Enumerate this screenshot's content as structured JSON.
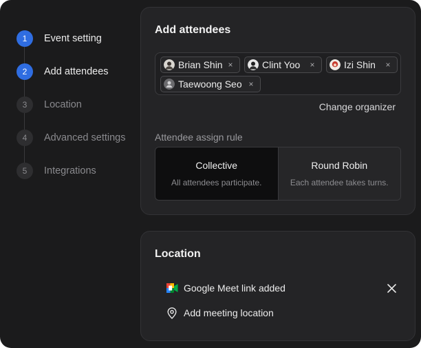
{
  "steps": [
    {
      "number": "1",
      "label": "Event setting",
      "active": true
    },
    {
      "number": "2",
      "label": "Add attendees",
      "active": true
    },
    {
      "number": "3",
      "label": "Location",
      "active": false
    },
    {
      "number": "4",
      "label": "Advanced settings",
      "active": false
    },
    {
      "number": "5",
      "label": "Integrations",
      "active": false
    }
  ],
  "attendees_card": {
    "title": "Add attendees",
    "attendees": [
      {
        "name": "Brian Shin",
        "remove": "×"
      },
      {
        "name": "Clint Yoo",
        "remove": "×"
      },
      {
        "name": "Izi Shin",
        "remove": "×"
      },
      {
        "name": "Taewoong Seo",
        "remove": "×"
      }
    ],
    "change_organizer": "Change organizer",
    "rule_label": "Attendee assign rule",
    "rules": [
      {
        "title": "Collective",
        "description": "All attendees participate.",
        "selected": true
      },
      {
        "title": "Round Robin",
        "description": "Each attendee takes turns.",
        "selected": false
      }
    ]
  },
  "location_card": {
    "title": "Location",
    "meet_text": "Google Meet link added",
    "add_location_text": "Add meeting location"
  },
  "colors": {
    "accent": "#2f6de1",
    "background": "#1b1b1c",
    "card": "#242426"
  },
  "icons": {
    "meet": "google-meet-icon",
    "pin": "map-pin-icon",
    "close": "close-icon"
  }
}
